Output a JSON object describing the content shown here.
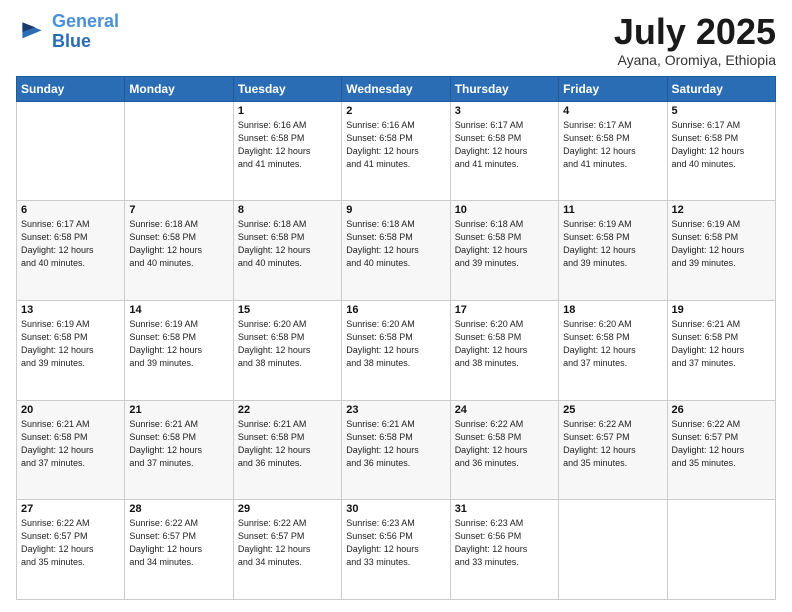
{
  "header": {
    "logo_line1": "General",
    "logo_line2": "Blue",
    "month_title": "July 2025",
    "location": "Ayana, Oromiya, Ethiopia"
  },
  "weekdays": [
    "Sunday",
    "Monday",
    "Tuesday",
    "Wednesday",
    "Thursday",
    "Friday",
    "Saturday"
  ],
  "weeks": [
    [
      {
        "day": "",
        "info": ""
      },
      {
        "day": "",
        "info": ""
      },
      {
        "day": "1",
        "info": "Sunrise: 6:16 AM\nSunset: 6:58 PM\nDaylight: 12 hours\nand 41 minutes."
      },
      {
        "day": "2",
        "info": "Sunrise: 6:16 AM\nSunset: 6:58 PM\nDaylight: 12 hours\nand 41 minutes."
      },
      {
        "day": "3",
        "info": "Sunrise: 6:17 AM\nSunset: 6:58 PM\nDaylight: 12 hours\nand 41 minutes."
      },
      {
        "day": "4",
        "info": "Sunrise: 6:17 AM\nSunset: 6:58 PM\nDaylight: 12 hours\nand 41 minutes."
      },
      {
        "day": "5",
        "info": "Sunrise: 6:17 AM\nSunset: 6:58 PM\nDaylight: 12 hours\nand 40 minutes."
      }
    ],
    [
      {
        "day": "6",
        "info": "Sunrise: 6:17 AM\nSunset: 6:58 PM\nDaylight: 12 hours\nand 40 minutes."
      },
      {
        "day": "7",
        "info": "Sunrise: 6:18 AM\nSunset: 6:58 PM\nDaylight: 12 hours\nand 40 minutes."
      },
      {
        "day": "8",
        "info": "Sunrise: 6:18 AM\nSunset: 6:58 PM\nDaylight: 12 hours\nand 40 minutes."
      },
      {
        "day": "9",
        "info": "Sunrise: 6:18 AM\nSunset: 6:58 PM\nDaylight: 12 hours\nand 40 minutes."
      },
      {
        "day": "10",
        "info": "Sunrise: 6:18 AM\nSunset: 6:58 PM\nDaylight: 12 hours\nand 39 minutes."
      },
      {
        "day": "11",
        "info": "Sunrise: 6:19 AM\nSunset: 6:58 PM\nDaylight: 12 hours\nand 39 minutes."
      },
      {
        "day": "12",
        "info": "Sunrise: 6:19 AM\nSunset: 6:58 PM\nDaylight: 12 hours\nand 39 minutes."
      }
    ],
    [
      {
        "day": "13",
        "info": "Sunrise: 6:19 AM\nSunset: 6:58 PM\nDaylight: 12 hours\nand 39 minutes."
      },
      {
        "day": "14",
        "info": "Sunrise: 6:19 AM\nSunset: 6:58 PM\nDaylight: 12 hours\nand 39 minutes."
      },
      {
        "day": "15",
        "info": "Sunrise: 6:20 AM\nSunset: 6:58 PM\nDaylight: 12 hours\nand 38 minutes."
      },
      {
        "day": "16",
        "info": "Sunrise: 6:20 AM\nSunset: 6:58 PM\nDaylight: 12 hours\nand 38 minutes."
      },
      {
        "day": "17",
        "info": "Sunrise: 6:20 AM\nSunset: 6:58 PM\nDaylight: 12 hours\nand 38 minutes."
      },
      {
        "day": "18",
        "info": "Sunrise: 6:20 AM\nSunset: 6:58 PM\nDaylight: 12 hours\nand 37 minutes."
      },
      {
        "day": "19",
        "info": "Sunrise: 6:21 AM\nSunset: 6:58 PM\nDaylight: 12 hours\nand 37 minutes."
      }
    ],
    [
      {
        "day": "20",
        "info": "Sunrise: 6:21 AM\nSunset: 6:58 PM\nDaylight: 12 hours\nand 37 minutes."
      },
      {
        "day": "21",
        "info": "Sunrise: 6:21 AM\nSunset: 6:58 PM\nDaylight: 12 hours\nand 37 minutes."
      },
      {
        "day": "22",
        "info": "Sunrise: 6:21 AM\nSunset: 6:58 PM\nDaylight: 12 hours\nand 36 minutes."
      },
      {
        "day": "23",
        "info": "Sunrise: 6:21 AM\nSunset: 6:58 PM\nDaylight: 12 hours\nand 36 minutes."
      },
      {
        "day": "24",
        "info": "Sunrise: 6:22 AM\nSunset: 6:58 PM\nDaylight: 12 hours\nand 36 minutes."
      },
      {
        "day": "25",
        "info": "Sunrise: 6:22 AM\nSunset: 6:57 PM\nDaylight: 12 hours\nand 35 minutes."
      },
      {
        "day": "26",
        "info": "Sunrise: 6:22 AM\nSunset: 6:57 PM\nDaylight: 12 hours\nand 35 minutes."
      }
    ],
    [
      {
        "day": "27",
        "info": "Sunrise: 6:22 AM\nSunset: 6:57 PM\nDaylight: 12 hours\nand 35 minutes."
      },
      {
        "day": "28",
        "info": "Sunrise: 6:22 AM\nSunset: 6:57 PM\nDaylight: 12 hours\nand 34 minutes."
      },
      {
        "day": "29",
        "info": "Sunrise: 6:22 AM\nSunset: 6:57 PM\nDaylight: 12 hours\nand 34 minutes."
      },
      {
        "day": "30",
        "info": "Sunrise: 6:23 AM\nSunset: 6:56 PM\nDaylight: 12 hours\nand 33 minutes."
      },
      {
        "day": "31",
        "info": "Sunrise: 6:23 AM\nSunset: 6:56 PM\nDaylight: 12 hours\nand 33 minutes."
      },
      {
        "day": "",
        "info": ""
      },
      {
        "day": "",
        "info": ""
      }
    ]
  ]
}
